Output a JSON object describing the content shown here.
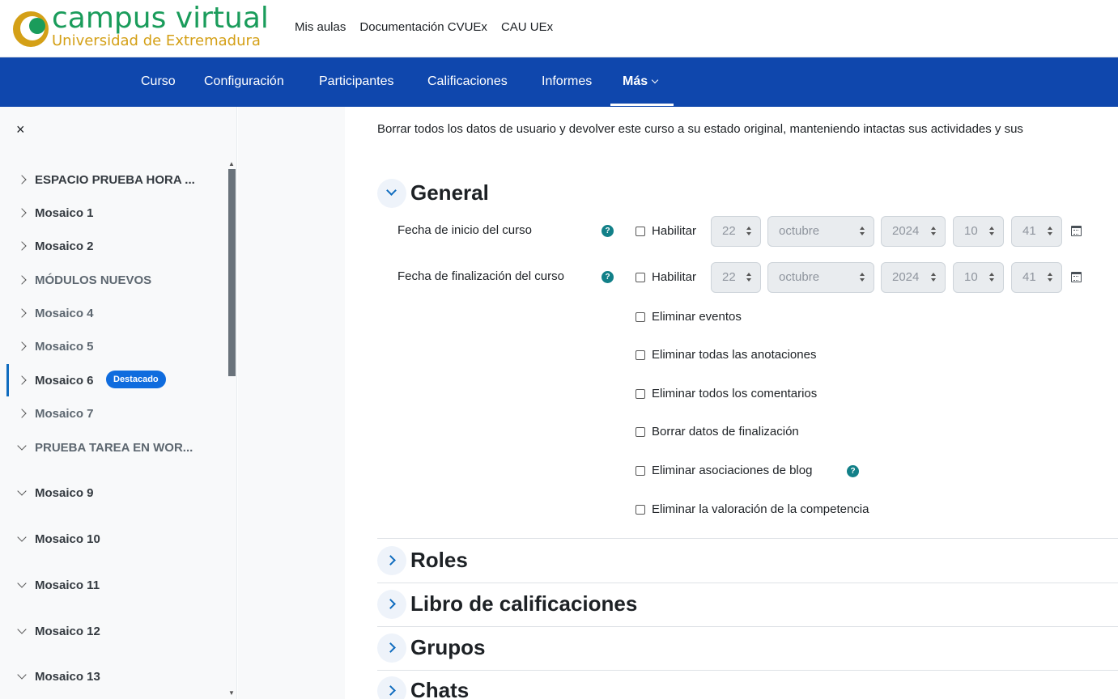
{
  "header": {
    "logo_title": "campus virtual",
    "logo_subtitle": "Universidad de Extremadura",
    "links": [
      "Mis aulas",
      "Documentación CVUEx",
      "CAU UEx"
    ]
  },
  "nav": {
    "items": [
      "Curso",
      "Configuración",
      "Participantes",
      "Calificaciones",
      "Informes",
      "Más"
    ],
    "active": "Más"
  },
  "drawer": {
    "close_label": "×",
    "items": [
      {
        "label": "ESPACIO PRUEBA HORA ...",
        "state": "collapsed"
      },
      {
        "label": "Mosaico 1",
        "state": "collapsed"
      },
      {
        "label": "Mosaico 2",
        "state": "collapsed"
      },
      {
        "label": "MÓDULOS NUEVOS",
        "state": "collapsed"
      },
      {
        "label": "Mosaico 4",
        "state": "collapsed"
      },
      {
        "label": "Mosaico 5",
        "state": "collapsed"
      },
      {
        "label": "Mosaico 6",
        "state": "collapsed",
        "badge": "Destacado",
        "active": true
      },
      {
        "label": "Mosaico 7",
        "state": "collapsed"
      },
      {
        "label": "PRUEBA TAREA EN WOR...",
        "state": "expanded"
      },
      {
        "label": "Mosaico 9",
        "state": "expanded"
      },
      {
        "label": "Mosaico 10",
        "state": "expanded"
      },
      {
        "label": "Mosaico 11",
        "state": "expanded"
      },
      {
        "label": "Mosaico 12",
        "state": "expanded"
      },
      {
        "label": "Mosaico 13",
        "state": "expanded"
      }
    ]
  },
  "main": {
    "intro": "Borrar todos los datos de usuario y devolver este curso a su estado original, manteniendo intactas sus actividades y sus",
    "general": {
      "title": "General",
      "start_label": "Fecha de inicio del curso",
      "end_label": "Fecha de finalización del curso",
      "enable_label": "Habilitar",
      "date": {
        "day": "22",
        "month": "octubre",
        "year": "2024",
        "hour": "10",
        "minute": "41"
      },
      "options": [
        "Eliminar eventos",
        "Eliminar todas las anotaciones",
        "Eliminar todos los comentarios",
        "Borrar datos de finalización",
        "Eliminar asociaciones de blog",
        "Eliminar la valoración de la competencia"
      ],
      "help_glyph": "?"
    },
    "sections": [
      "Roles",
      "Libro de calificaciones",
      "Grupos",
      "Chats"
    ]
  },
  "colors": {
    "nav_bg": "#0f47ad",
    "logo_green": "#1a9c5b",
    "logo_gold": "#d4a017",
    "badge_blue": "#0f6cde",
    "help_teal": "#128088"
  }
}
